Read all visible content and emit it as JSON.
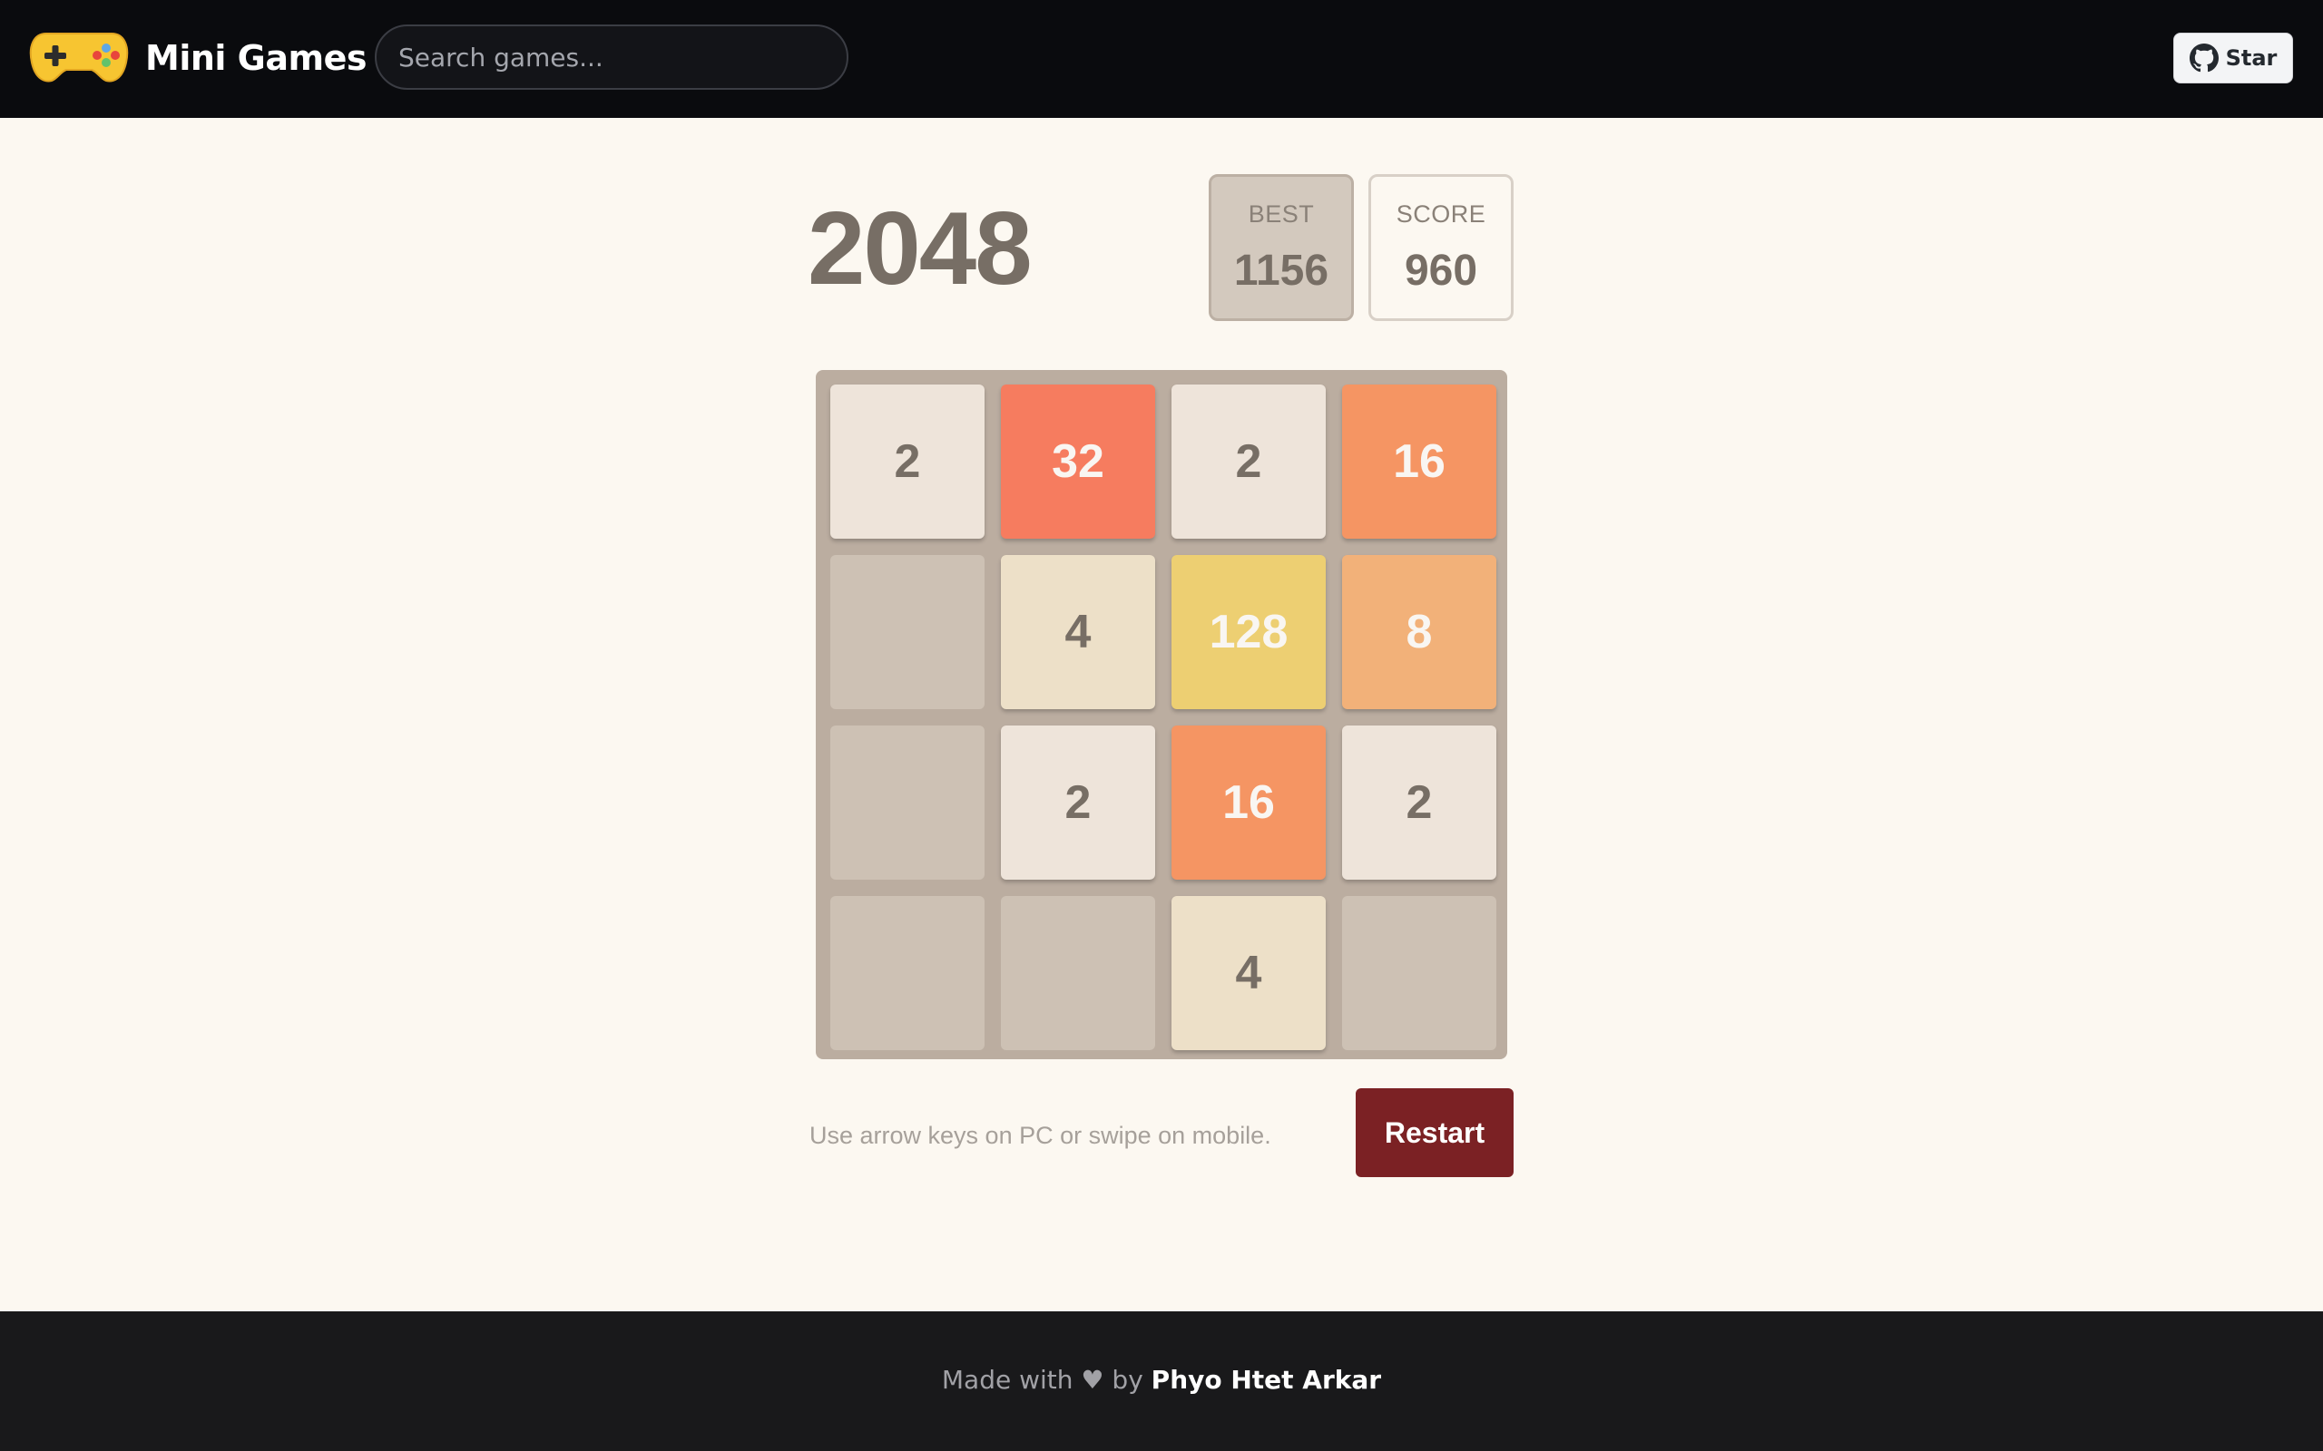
{
  "header": {
    "brand": "Mini Games",
    "logo_icon": "gamepad-icon",
    "search_placeholder": "Search games...",
    "star_label": "Star",
    "star_icon": "github-icon"
  },
  "game": {
    "title": "2048",
    "best_label": "BEST",
    "best_value": "1156",
    "score_label": "SCORE",
    "score_value": "960",
    "board": [
      [
        2,
        32,
        2,
        16
      ],
      [
        null,
        4,
        128,
        8
      ],
      [
        null,
        2,
        16,
        2
      ],
      [
        null,
        null,
        4,
        null
      ]
    ],
    "hint": "Use arrow keys on PC or swipe on mobile.",
    "restart_label": "Restart"
  },
  "footer": {
    "prefix": "Made with ♥ by ",
    "author": "Phyo Htet Arkar"
  },
  "colors": {
    "tile_2": "#eee4da",
    "tile_4": "#ede0c8",
    "tile_8": "#f2b179",
    "tile_16": "#f59563",
    "tile_32": "#f67c5f",
    "tile_128": "#edcf72",
    "empty_cell": "#cdc1b4",
    "board_bg": "#bbada0",
    "restart_bg": "#7b2124",
    "header_bg": "#0a0b0e",
    "footer_bg": "#19191b"
  }
}
